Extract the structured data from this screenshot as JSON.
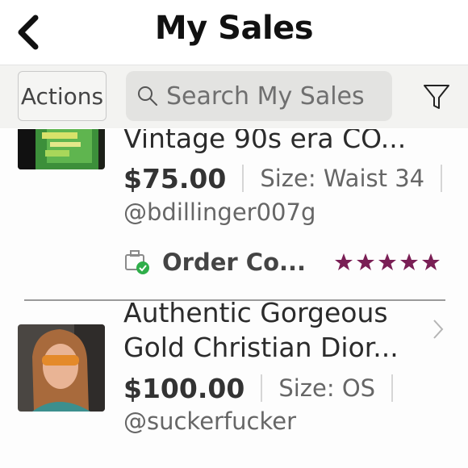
{
  "header": {
    "title": "My Sales",
    "back_icon": "chevron-left-icon"
  },
  "toolbar": {
    "actions_label": "Actions",
    "search_placeholder": "Search My Sales",
    "search_icon": "search-icon",
    "filter_icon": "filter-icon"
  },
  "sales": [
    {
      "title": "Vintage 90s era CO...",
      "price": "$75.00",
      "size": "Size: Waist 34",
      "seller": "@bdillinger007g",
      "status": "Order Co...",
      "status_icon": "order-complete-icon",
      "rating": 5
    },
    {
      "title_line1": "Authentic Gorgeous",
      "title_line2": "Gold Christian Dior...",
      "price": "$100.00",
      "size": "Size: OS",
      "seller": "@suckerfucker",
      "chevron_icon": "chevron-right-icon"
    }
  ],
  "colors": {
    "star": "#7a1f55",
    "status_check": "#2fae4a",
    "toolbar_bg": "#f3f3f1",
    "search_bg": "#e3e3e1"
  }
}
